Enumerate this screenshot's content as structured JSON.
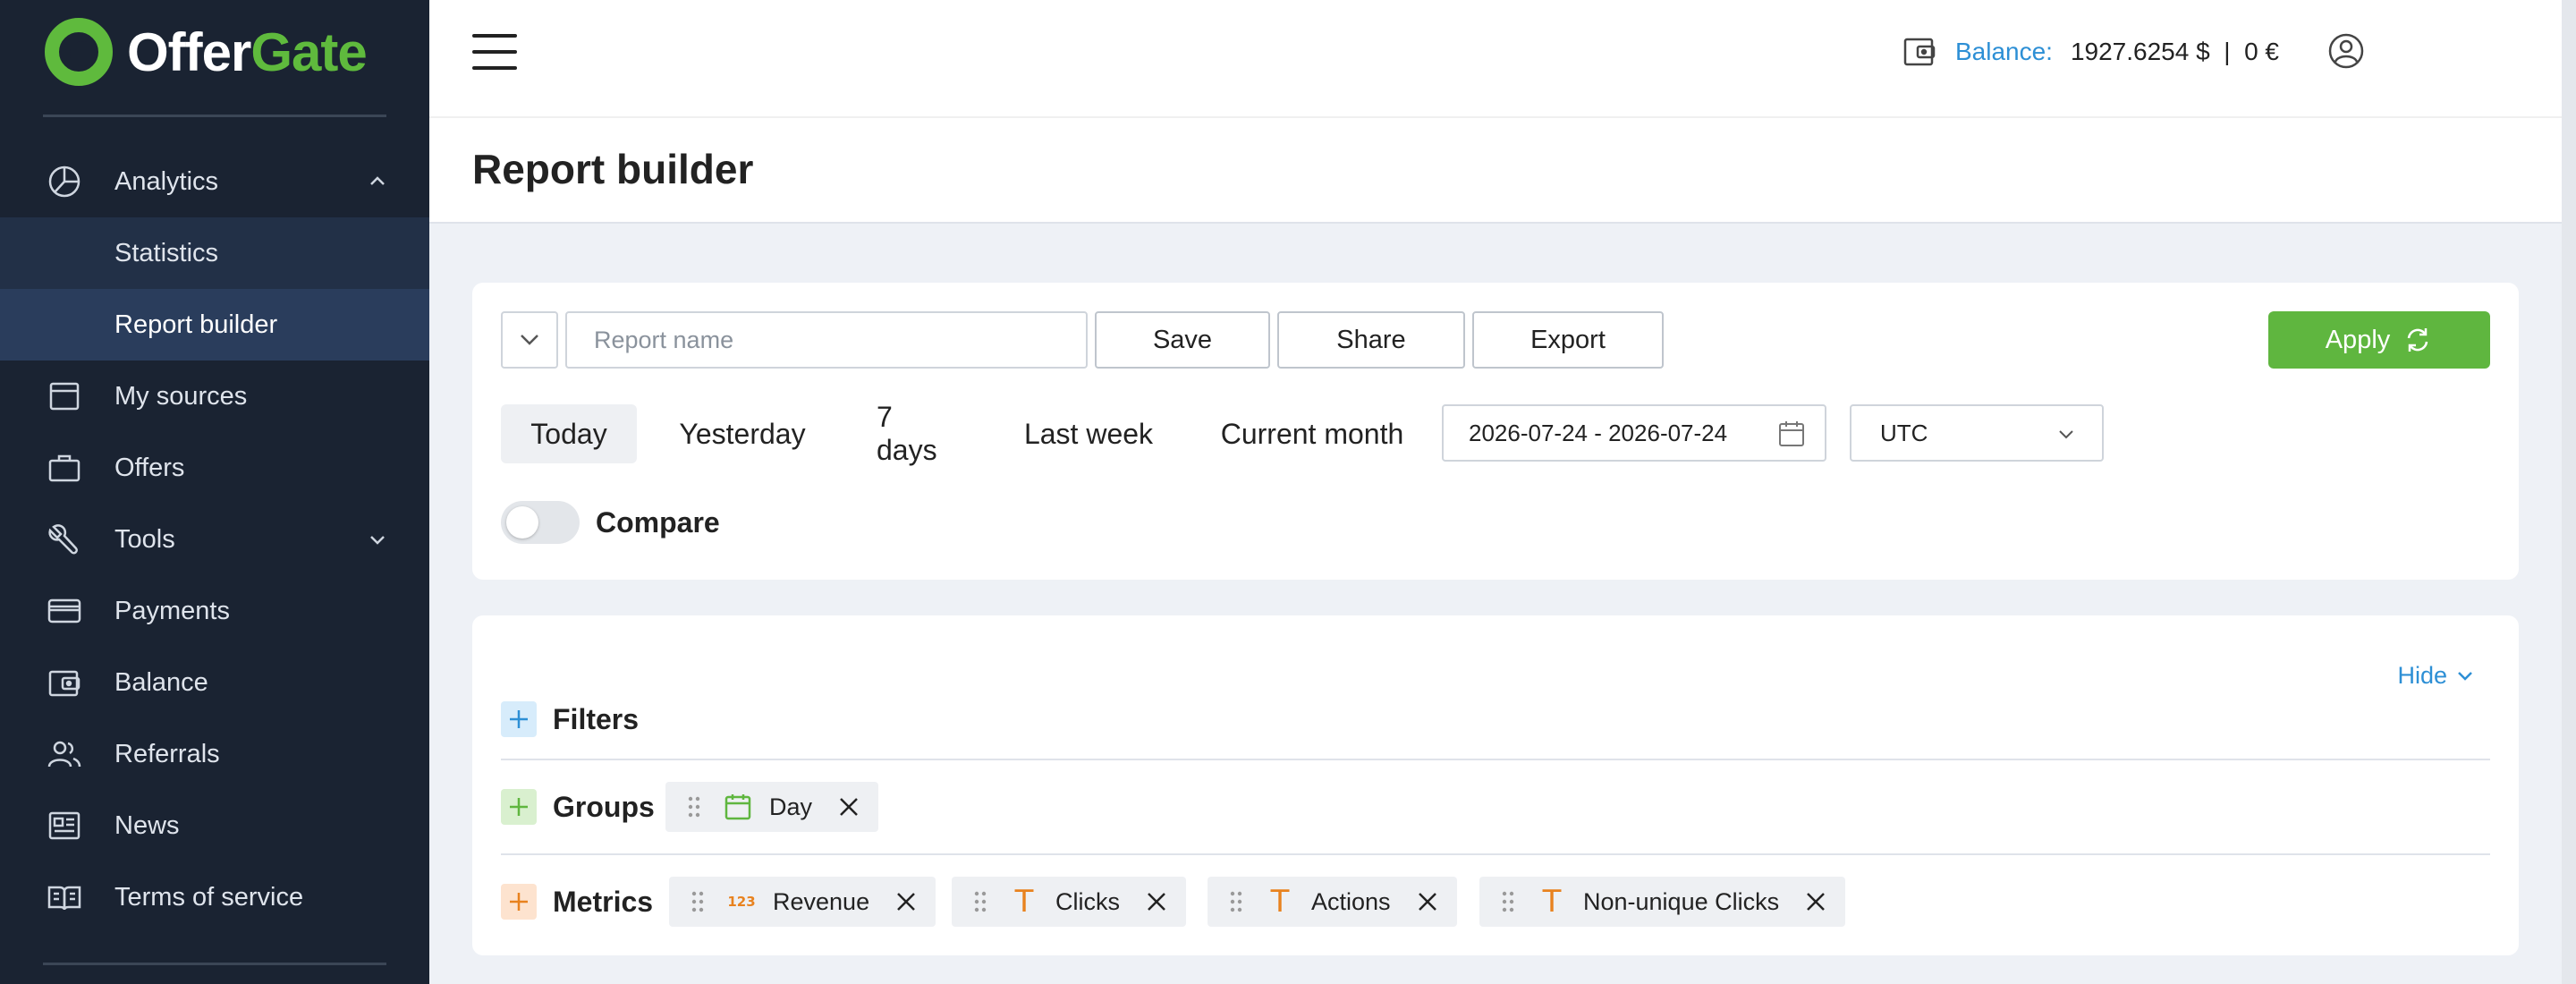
{
  "brand": {
    "name_part1": "Offer",
    "name_part2": "Gate",
    "accent": "#5fba3d",
    "sidebar_bg": "#1a2332"
  },
  "sidebar": {
    "items": [
      {
        "label": "Analytics",
        "icon": "pie-chart-icon",
        "expanded": true
      },
      {
        "label": "Statistics",
        "sub": true
      },
      {
        "label": "Report builder",
        "sub": true,
        "active": true
      },
      {
        "label": "My sources",
        "icon": "window-icon"
      },
      {
        "label": "Offers",
        "icon": "briefcase-icon"
      },
      {
        "label": "Tools",
        "icon": "wrench-icon",
        "expandable": true
      },
      {
        "label": "Payments",
        "icon": "credit-card-icon"
      },
      {
        "label": "Balance",
        "icon": "wallet-icon"
      },
      {
        "label": "Referrals",
        "icon": "users-icon"
      },
      {
        "label": "News",
        "icon": "newspaper-icon"
      },
      {
        "label": "Terms of service",
        "icon": "book-icon"
      }
    ]
  },
  "header": {
    "balance_label": "Balance:",
    "balance_value": "1927.6254 $  |  0 €"
  },
  "page": {
    "title": "Report builder"
  },
  "toolbar": {
    "report_name_placeholder": "Report name",
    "save_label": "Save",
    "share_label": "Share",
    "export_label": "Export",
    "apply_label": "Apply"
  },
  "periods": [
    {
      "label": "Today",
      "active": true
    },
    {
      "label": "Yesterday"
    },
    {
      "label": "7 days"
    },
    {
      "label": "Last week"
    },
    {
      "label": "Current month"
    }
  ],
  "date_range": "2026-07-24 - 2026-07-24",
  "timezone": "UTC",
  "compare": {
    "label": "Compare",
    "enabled": false
  },
  "builder": {
    "hide_label": "Hide",
    "filters_label": "Filters",
    "groups_label": "Groups",
    "metrics_label": "Metrics",
    "groups": [
      {
        "label": "Day",
        "icon": "calendar-icon"
      }
    ],
    "metrics": [
      {
        "label": "Revenue",
        "icon": "number-icon",
        "glyph": "123"
      },
      {
        "label": "Clicks",
        "icon": "text-type-icon",
        "glyph": "T"
      },
      {
        "label": "Actions",
        "icon": "text-type-icon",
        "glyph": "T"
      },
      {
        "label": "Non-unique Clicks",
        "icon": "text-type-icon",
        "glyph": "T"
      }
    ]
  }
}
